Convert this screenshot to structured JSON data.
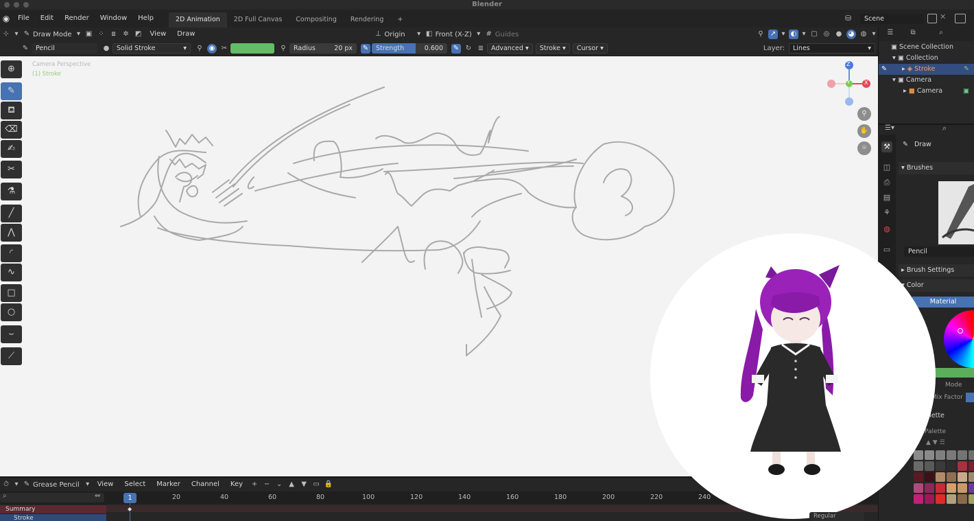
{
  "app": {
    "title": "Blender"
  },
  "menu": {
    "items": [
      "File",
      "Edit",
      "Render",
      "Window",
      "Help"
    ]
  },
  "workspaces": {
    "tabs": [
      "2D Animation",
      "2D Full Canvas",
      "Compositing",
      "Rendering"
    ],
    "active": "2D Animation",
    "add": "+"
  },
  "scene": {
    "name": "Scene"
  },
  "header": {
    "mode": "Draw Mode",
    "view": "View",
    "draw": "Draw",
    "origin": "Origin",
    "orientation": "Front (X-Z)",
    "guides": "Guides"
  },
  "tool_header": {
    "brush": "Pencil",
    "stroke_type": "Solid Stroke",
    "color_hex": "#66bb66",
    "radius_label": "Radius",
    "radius_value": "20 px",
    "strength_label": "Strength",
    "strength_value": "0.600",
    "advanced": "Advanced",
    "stroke": "Stroke",
    "cursor": "Cursor",
    "layer_label": "Layer:",
    "layer_value": "Lines"
  },
  "viewport": {
    "camera_label": "Camera Perspective",
    "object_label": "(1) Stroke",
    "gizmo_x": "X",
    "gizmo_y": "Y",
    "gizmo_z": "Z"
  },
  "outliner": {
    "root": "Scene Collection",
    "collection": "Collection",
    "items": [
      "Stroke",
      "Camera",
      "Camera"
    ]
  },
  "properties": {
    "tool_name": "Draw",
    "brushes_label": "Brushes",
    "brush_name": "Pencil",
    "brush_settings": "Brush Settings",
    "color_label": "Color",
    "material_tab": "Material",
    "mode_label": "Mode",
    "mix_factor_label": "Mix Factor",
    "palette_label": "Palette",
    "palette_sub": "Palette",
    "palette_colors": [
      "#8a8a8a",
      "#8a8a8a",
      "#7f7f7f",
      "#7a7a7a",
      "#747474",
      "#6e6e6e",
      "#6a6a6a",
      "#5a5a5a",
      "#3a3a3a",
      "#2e2e2e",
      "#a83040",
      "#7a1f2f",
      "#5a1a24",
      "#3a1218",
      "#b08a6a",
      "#8e6e54",
      "#c8aa8a",
      "#9e8a6e",
      "#b04a7a",
      "#8a2a5a",
      "#c82a3a",
      "#d0a070",
      "#c89a6a",
      "#6a3a9a",
      "#c0207a",
      "#a01858",
      "#e02a2a",
      "#b0a080",
      "#8a6a4a",
      "#a0a060"
    ]
  },
  "timeline": {
    "editor": "Grease Pencil",
    "menus": [
      "View",
      "Select",
      "Marker",
      "Channel",
      "Key"
    ],
    "current_frame": "1",
    "frames": [
      "20",
      "40",
      "60",
      "80",
      "100",
      "120",
      "140",
      "160",
      "180",
      "200",
      "220",
      "240"
    ],
    "summary": "Summary",
    "stroke": "Stroke",
    "blend_label": "Regular"
  }
}
